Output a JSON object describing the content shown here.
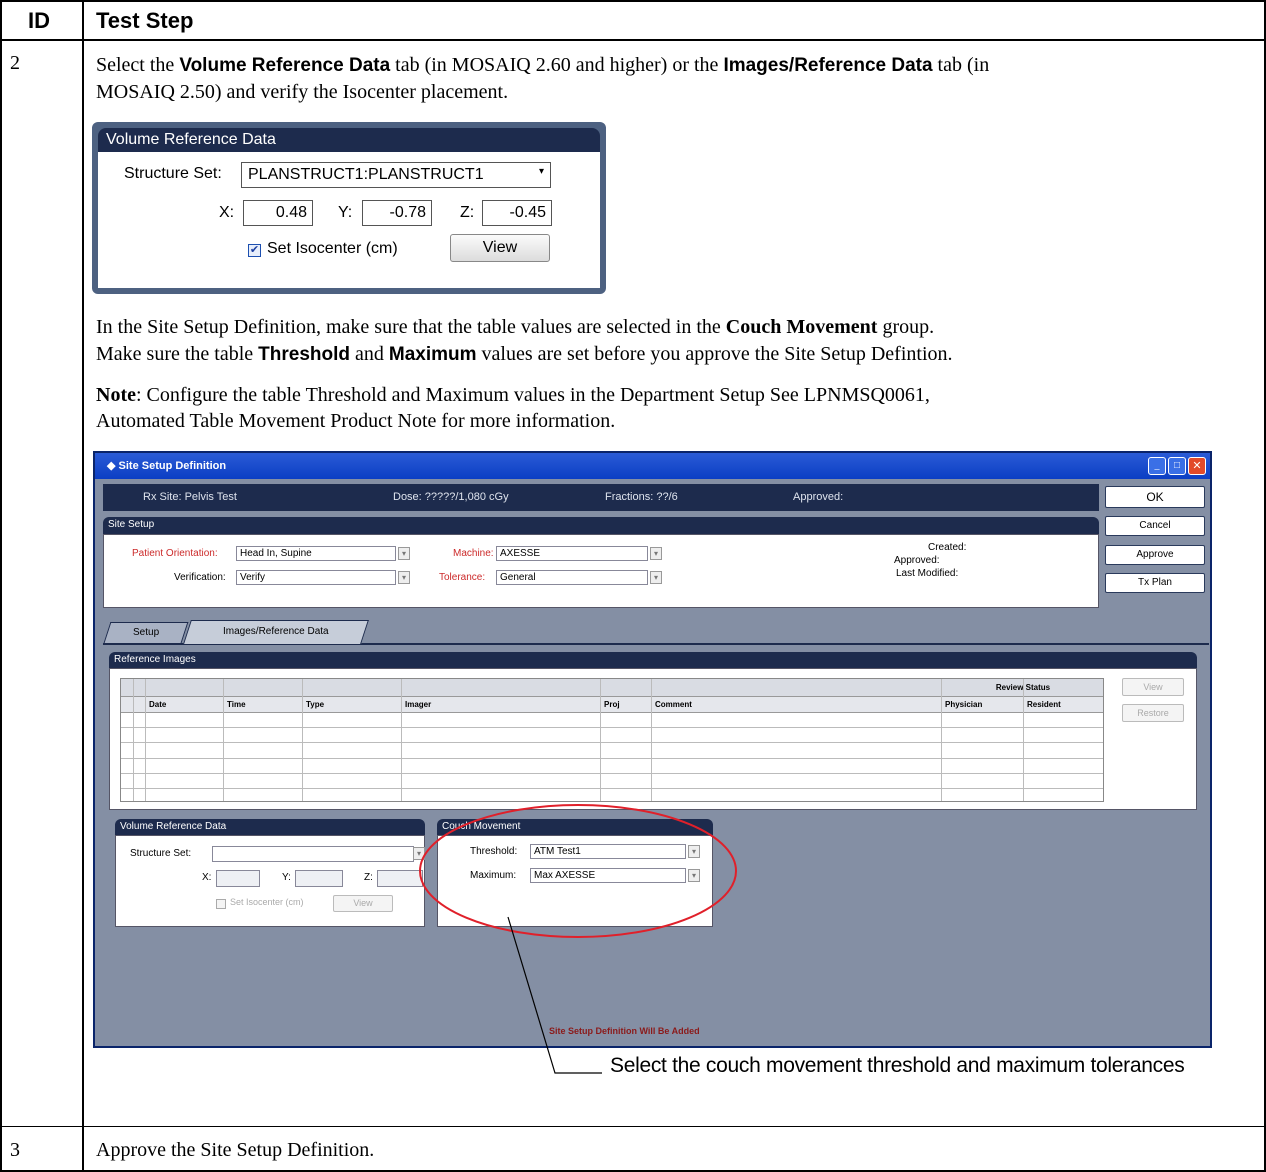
{
  "table": {
    "header_id": "ID",
    "header_step": "Test Step",
    "row2_id": "2",
    "row3_id": "3",
    "row3_text": "Approve the Site Setup Definition."
  },
  "step2": {
    "p1_a": "Select the ",
    "p1_b": "Volume Reference Data",
    "p1_c": " tab (in MOSAIQ 2.60 and higher) or the ",
    "p1_d": "Images/Reference Data",
    "p1_e": " tab (in",
    "p1_f": "MOSAIQ 2.50) and verify the Isocenter placement.",
    "p2_a": "In the Site Setup Definition, make sure that the table values are selected in the ",
    "p2_b": "Couch Movement",
    "p2_c": " group.",
    "p3_a": "Make sure the table ",
    "p3_b": "Threshold",
    "p3_c": " and ",
    "p3_d": "Maximum",
    "p3_e": " values are set before you approve the Site Setup Defintion.",
    "note_label": "Note",
    "note_line1": ": Configure the table Threshold and Maximum values in the Department Setup  See LPNMSQ0061,",
    "note_line2": "Automated Table Movement Product Note for more information.",
    "callout": "Select the couch movement threshold and maximum tolerances"
  },
  "vrd_panel": {
    "title": "Volume Reference Data",
    "structure_label": "Structure Set:",
    "structure_value": "PLANSTRUCT1:PLANSTRUCT1",
    "x_label": "X:",
    "x_value": "0.48",
    "y_label": "Y:",
    "y_value": "-0.78",
    "z_label": "Z:",
    "z_value": "-0.45",
    "isocenter_label": "Set Isocenter (cm)",
    "view_button": "View"
  },
  "site_setup": {
    "window_title": "Site Setup Definition",
    "rx_site": "Rx Site: Pelvis Test",
    "dose": "Dose: ?????/1,080 cGy",
    "fractions": "Fractions: ??/6",
    "approved": "Approved:",
    "ok": "OK",
    "cancel": "Cancel",
    "approve": "Approve",
    "tx_plan": "Tx Plan",
    "site_setup_header": "Site Setup",
    "patient_orientation_label": "Patient Orientation:",
    "patient_orientation_value": "Head In, Supine",
    "verification_label": "Verification:",
    "verification_value": "Verify",
    "machine_label": "Machine:",
    "machine_value": "AXESSE",
    "tolerance_label": "Tolerance:",
    "tolerance_value": "General",
    "created": "Created:",
    "approved_meta": "Approved:",
    "last_modified": "Last Modified:",
    "tab_setup": "Setup",
    "tab_images": "Images/Reference Data",
    "ref_images_header": "Reference Images",
    "review_status": "Review Status",
    "columns": [
      "Date",
      "Time",
      "Type",
      "Imager",
      "Proj",
      "Comment",
      "Physician",
      "Resident"
    ],
    "view_btn": "View",
    "restore_btn": "Restore",
    "vrd_header": "Volume Reference Data",
    "vrd_structure": "Structure Set:",
    "vrd_x": "X:",
    "vrd_y": "Y:",
    "vrd_z": "Z:",
    "vrd_isocenter": "Set Isocenter (cm)",
    "vrd_view": "View",
    "couch_header": "Couch Movement",
    "threshold_label": "Threshold:",
    "threshold_value": "ATM Test1",
    "maximum_label": "Maximum:",
    "maximum_value": "Max AXESSE",
    "status_text": "Site Setup Definition Will Be Added"
  },
  "colors": {
    "panel_header": "#1d2b4d",
    "panel_bg": "#4d6181",
    "window_bg": "#848fa4",
    "required_label": "#cc2a2a",
    "status_text": "#8b1a1a",
    "ellipse": "#e0202a"
  }
}
